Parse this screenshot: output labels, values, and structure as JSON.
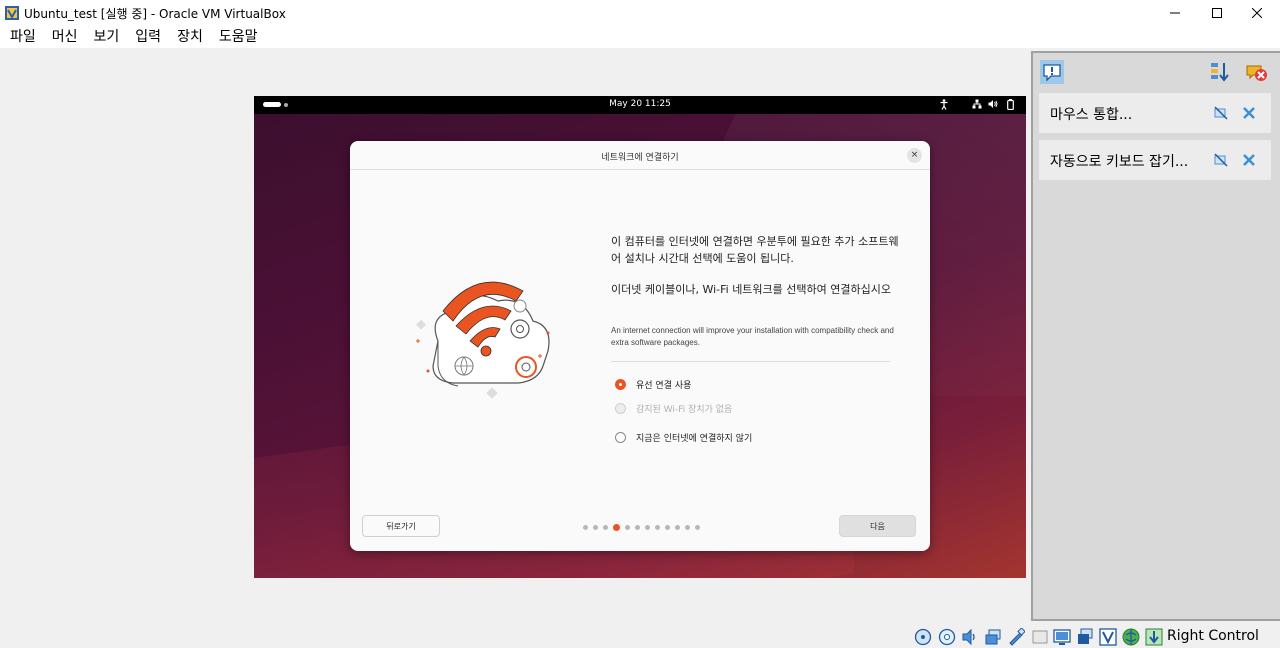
{
  "window": {
    "title": "Ubuntu_test [실행 중] - Oracle VM VirtualBox",
    "controls": [
      "minimize",
      "maximize",
      "close"
    ]
  },
  "menubar": {
    "items": [
      "파일",
      "머신",
      "보기",
      "입력",
      "장치",
      "도움말"
    ]
  },
  "guest": {
    "topbar": {
      "clock": "May 20  11:25"
    },
    "dialog": {
      "title": "네트워크에 연결하기",
      "close_symbol": "×",
      "intro_paragraph": "이 컴퓨터를 인터넷에 연결하면 우분투에 필요한 추가 소프트웨어 설치나 시간대 선택에 도움이 됩니다.",
      "instruction": "이더넷 케이블이나, Wi-Fi 네트워크를 선택하여 연결하십시오",
      "note": "An internet connection will improve your installation with compatibility check and extra software packages.",
      "options": [
        {
          "label": "유선 연결 사용",
          "checked": true,
          "disabled": false
        },
        {
          "label": "감지된 Wi-Fi 장치가 없음",
          "checked": false,
          "disabled": true
        },
        {
          "label": "지금은 인터넷에 연결하지 않기",
          "checked": false,
          "disabled": false
        }
      ],
      "back_button": "뒤로가기",
      "next_button": "다음",
      "pager": {
        "total": 12,
        "current": 4
      }
    }
  },
  "notifications": {
    "items": [
      {
        "text": "마우스 통합..."
      },
      {
        "text": "자동으로 키보드 잡기..."
      }
    ]
  },
  "statusbar": {
    "host_key": "Right Control"
  },
  "colors": {
    "accent": "#e95420",
    "guest_topbar": "#000000",
    "panel": "#d9d9d9"
  }
}
